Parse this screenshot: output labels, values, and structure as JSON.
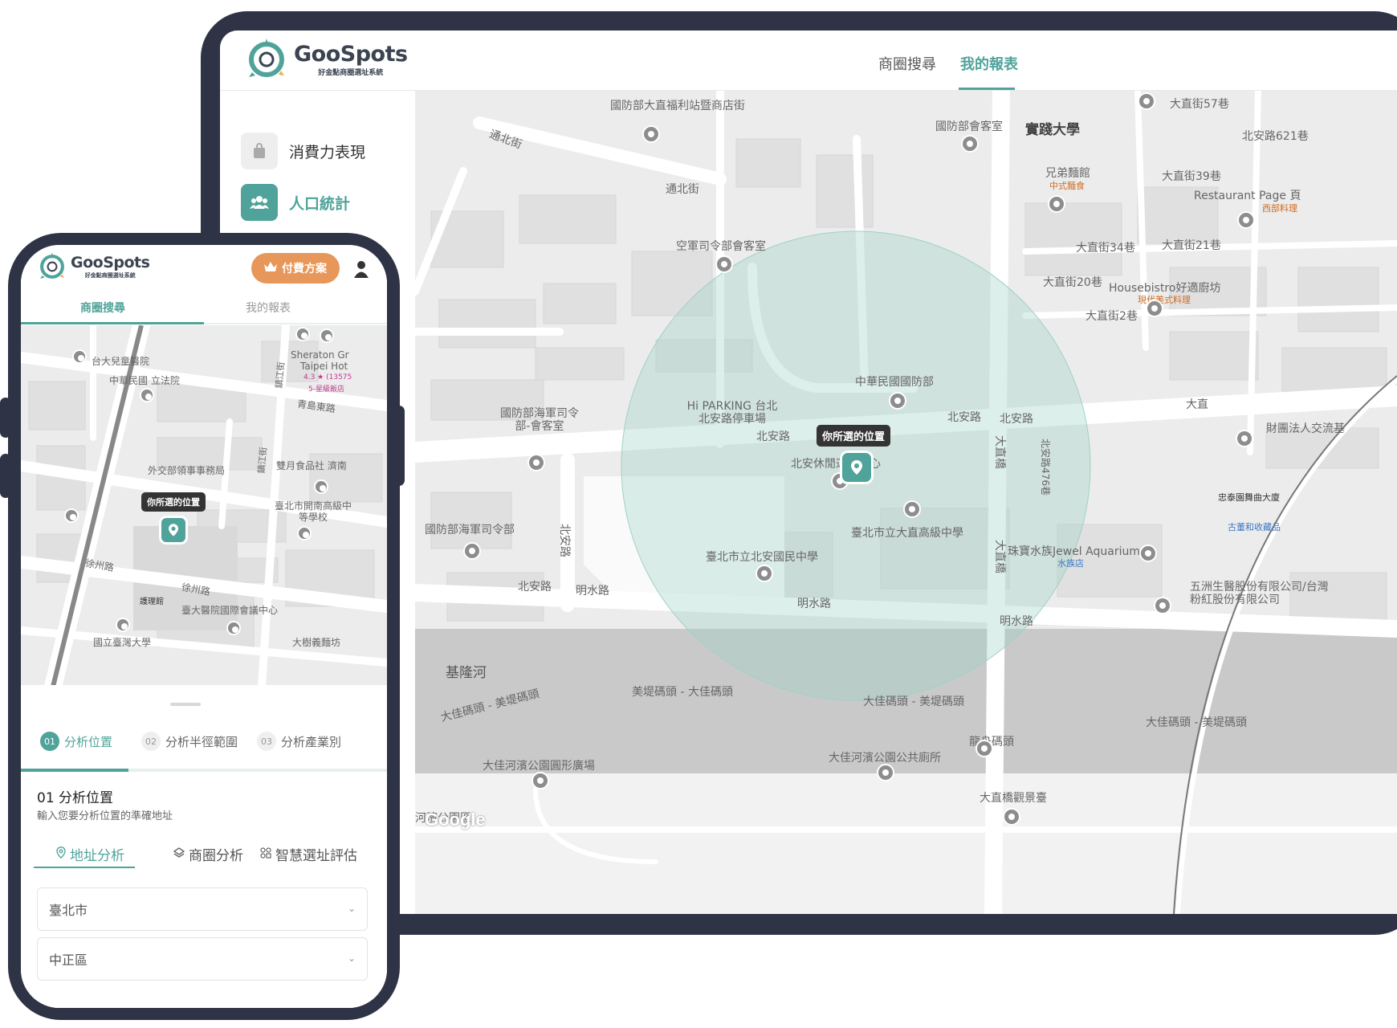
{
  "brand": {
    "name": "GooSpots",
    "tagline": "好金點商圈選址系統",
    "teal": "#4fa39a",
    "orange": "#e8975a",
    "frame": "#2f3346"
  },
  "desktop": {
    "nav": [
      {
        "label": "商圈搜尋",
        "active": false
      },
      {
        "label": "我的報表",
        "active": true
      }
    ],
    "sidebar": [
      {
        "label": "消費力表現",
        "icon": "shopping-bag-icon",
        "active": false
      },
      {
        "label": "人口統計",
        "icon": "people-icon",
        "active": true
      }
    ],
    "map": {
      "marker_label": "你所選的位置",
      "labels": [
        "國防部大直福利站暨商店街",
        "通北街",
        "通北街",
        "國防部會客室",
        "實踐大學",
        "北安路621巷",
        "大直街57巷",
        "兄弟麵館",
        "中式麵食",
        "大直街39巷",
        "Restaurant Page 頁",
        "西部料理",
        "空軍司令部會客室",
        "大直街34巷",
        "大直街21巷",
        "大直街20巷",
        "Housebistro好適廚坊",
        "現代美式料理",
        "大直街2巷",
        "中華民國國防部",
        "Hi PARKING 台北北安路停車場",
        "北安路",
        "北安路",
        "北安路",
        "北安休閒運動中心",
        "國防部海軍司令部-會客室",
        "國防部海軍司令部",
        "臺北市立大直高級中學",
        "臺北市立北安國民中學",
        "北安路",
        "明水路",
        "明水路",
        "明水路",
        "珠寶水族Jewel Aquarium",
        "水族店",
        "財團法人交流基",
        "忠泰園舞曲大廈",
        "古董和收藏品",
        "五洲生醫股份有限公司/台灣粉紅股份有限公司",
        "大直",
        "基隆河",
        "大佳碼頭 - 美堤碼頭",
        "美堤碼頭 - 大佳碼頭",
        "大佳碼頭 - 美堤碼頭",
        "大佳碼頭 - 美堤碼頭",
        "龍舟碼頭",
        "大佳河濱公園公共廁所",
        "大佳河濱公園圓形廣場",
        "大直橋觀景臺",
        "大直橋",
        "大直橋",
        "北安路476巷",
        "河濱公園區",
        "北安路",
        "Google"
      ]
    }
  },
  "mobile": {
    "premium_button": "付費方案",
    "tabs": [
      {
        "label": "商圈搜尋",
        "active": true
      },
      {
        "label": "我的報表",
        "active": false
      }
    ],
    "map": {
      "marker_label": "你所選的位置",
      "labels": [
        "台大兒童醫院",
        "中華民國 立法院",
        "Sheraton Gr",
        "Taipei Hot",
        "4.3 ★ (13575",
        "5-星級飯店",
        "青島東路",
        "外交部領事事務局",
        "雙月食品社 濟南",
        "臺北市開南高級中等學校",
        "徐州路",
        "徐州路",
        "護理館",
        "臺大醫院國際會議中心",
        "國立臺灣大學",
        "大樹義麵坊",
        "鎮江街",
        "鎮江街"
      ]
    },
    "steps": [
      {
        "num": "01",
        "label": "分析位置",
        "active": true
      },
      {
        "num": "02",
        "label": "分析半徑範圍",
        "active": false
      },
      {
        "num": "03",
        "label": "分析產業別",
        "active": false
      }
    ],
    "section_title": "01 分析位置",
    "section_desc": "輸入您要分析位置的準確地址",
    "subtabs": [
      {
        "label": "地址分析",
        "icon": "location-icon",
        "active": true
      },
      {
        "label": "商圈分析",
        "icon": "layers-icon",
        "active": false
      },
      {
        "label": "智慧選址評估",
        "icon": "grid-icon",
        "active": false
      }
    ],
    "city": "臺北市",
    "district": "中正區"
  }
}
